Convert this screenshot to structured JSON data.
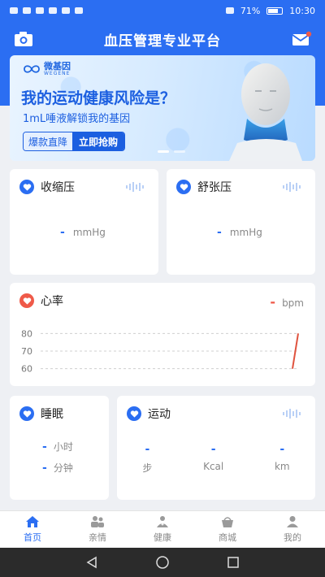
{
  "status_bar": {
    "battery": "71%",
    "time": "10:30"
  },
  "header": {
    "title": "血压管理专业平台"
  },
  "banner": {
    "brand_name": "微基因",
    "brand_sub": "WEGENE",
    "headline": "我的运动健康风险是？",
    "subline": "1mL唾液解锁我的基因",
    "cta_left": "爆款直降",
    "cta_right": "立即抢购"
  },
  "systolic": {
    "label": "收缩压",
    "value": "-",
    "unit": "mmHg"
  },
  "diastolic": {
    "label": "舒张压",
    "value": "-",
    "unit": "mmHg"
  },
  "heart_rate": {
    "label": "心率",
    "value": "-",
    "unit": "bpm",
    "y_ticks": [
      "80",
      "70",
      "60"
    ]
  },
  "chart_data": {
    "type": "line",
    "title": "",
    "xlabel": "",
    "ylabel": "",
    "y_ticks": [
      80,
      70,
      60
    ],
    "ylim": [
      58,
      82
    ],
    "series": [
      {
        "values": [
          60,
          80
        ]
      }
    ],
    "line_color": "#e0533f"
  },
  "sleep": {
    "label": "睡眠",
    "hours_value": "-",
    "hours_unit": "小时",
    "minutes_value": "-",
    "minutes_unit": "分钟"
  },
  "exercise": {
    "label": "运动",
    "steps_value": "-",
    "steps_unit": "步",
    "kcal_value": "-",
    "kcal_unit": "Kcal",
    "km_value": "-",
    "km_unit": "km"
  },
  "nav": {
    "home": "首页",
    "family": "亲情",
    "health": "健康",
    "mall": "商城",
    "mine": "我的"
  },
  "colors": {
    "primary": "#2b6ef2",
    "heart_red": "#ef5a49"
  }
}
